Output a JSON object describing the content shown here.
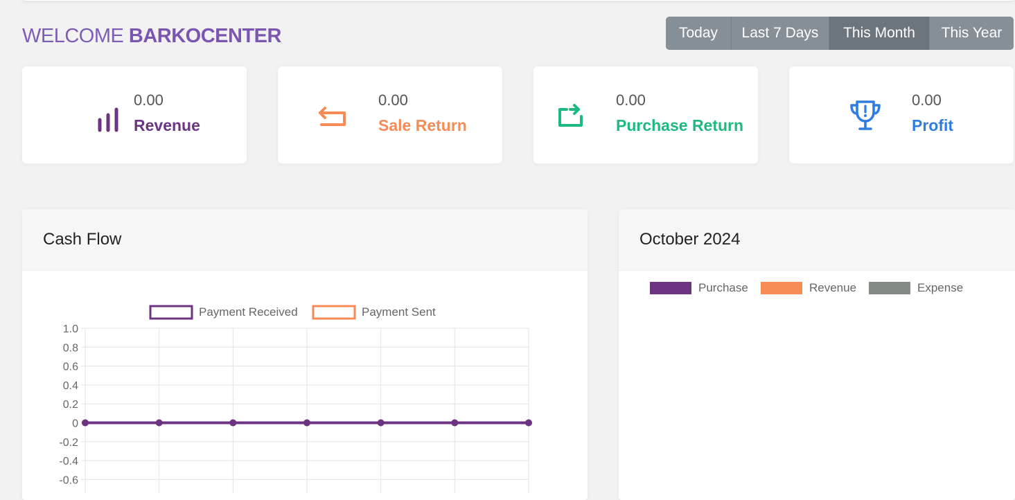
{
  "welcome": {
    "prefix": "WELCOME",
    "name": "BARKOCENTER"
  },
  "date_range": {
    "options": [
      "Today",
      "Last 7 Days",
      "This Month",
      "This Year"
    ],
    "selected": "This Month"
  },
  "stats": [
    {
      "value": "0.00",
      "label": "Revenue",
      "color": "#6c3483",
      "icon": "bar-chart-icon"
    },
    {
      "value": "0.00",
      "label": "Sale Return",
      "color": "#f68b55",
      "icon": "return-arrow-icon"
    },
    {
      "value": "0.00",
      "label": "Purchase Return",
      "color": "#1eb980",
      "icon": "repeat-icon"
    },
    {
      "value": "0.00",
      "label": "Profit",
      "color": "#2f7de1",
      "icon": "trophy-icon"
    }
  ],
  "cash_flow": {
    "title": "Cash Flow",
    "legend": [
      {
        "label": "Payment Received",
        "color": "#6c3483"
      },
      {
        "label": "Payment Sent",
        "color": "#f68b55"
      }
    ]
  },
  "monthly": {
    "title": "October 2024",
    "legend": [
      {
        "label": "Purchase",
        "color": "#6c3483"
      },
      {
        "label": "Revenue",
        "color": "#f68b55"
      },
      {
        "label": "Expense",
        "color": "#848b84"
      }
    ]
  },
  "chart_data": [
    {
      "type": "line",
      "title": "",
      "xlabel": "",
      "ylabel": "",
      "ylim": [
        -0.6,
        1.0
      ],
      "yticks": [
        "1.0",
        "0.8",
        "0.6",
        "0.4",
        "0.2",
        "0",
        "-0.2",
        "-0.4",
        "-0.6"
      ],
      "grid": true,
      "legend_position": "top",
      "series": [
        {
          "name": "Payment Received",
          "values": [
            0,
            0,
            0,
            0,
            0,
            0,
            0
          ]
        },
        {
          "name": "Payment Sent",
          "values": [
            0,
            0,
            0,
            0,
            0,
            0,
            0
          ]
        }
      ]
    },
    {
      "type": "bar",
      "title": "",
      "legend_position": "top",
      "series": [
        {
          "name": "Purchase",
          "values": []
        },
        {
          "name": "Revenue",
          "values": []
        },
        {
          "name": "Expense",
          "values": []
        }
      ]
    }
  ]
}
